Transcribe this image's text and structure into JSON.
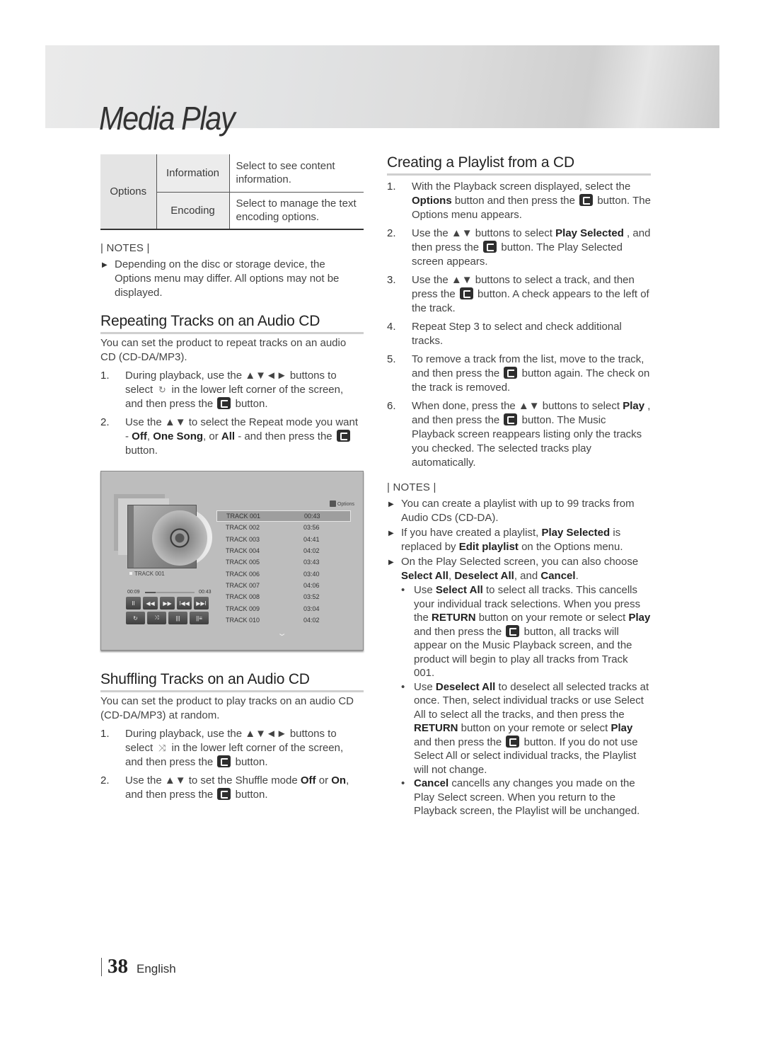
{
  "banner": {
    "title": "Media Play"
  },
  "options_table": {
    "group": "Options",
    "rows": [
      {
        "name": "Information",
        "desc": "Select to see content information."
      },
      {
        "name": "Encoding",
        "desc": "Select to manage the text encoding options."
      }
    ]
  },
  "notes_label": "| NOTES |",
  "left_notes": [
    "Depending on the disc or storage device, the Options menu may differ. All options may not be displayed."
  ],
  "repeat": {
    "title": "Repeating Tracks on an Audio CD",
    "intro": "You can set the product to repeat tracks on an audio CD (CD-DA/MP3).",
    "step1_num": "1.",
    "step1_a": "During playback, use the ▲▼◄► buttons to select",
    "step1_b": "in the lower left corner of the screen, and then press the",
    "step1_c": "button.",
    "step2_num": "2.",
    "step2_a": "Use the ▲▼ to select the Repeat mode you want -",
    "step2_off": "Off",
    "step2_sep1": ",",
    "step2_one": "One Song",
    "step2_sep2": ", or",
    "step2_all": "All",
    "step2_b": "- and then press the",
    "step2_c": "button."
  },
  "player": {
    "options_label": "Options",
    "now_playing": "TRACK 001",
    "time_current": "00:09",
    "time_total": "00:43",
    "progress": 0.21,
    "controls_row1": [
      "pause",
      "rewind",
      "fast-forward",
      "previous",
      "next"
    ],
    "controls_row1_glyphs": [
      "II",
      "◀◀",
      "▶▶",
      "I◀◀",
      "▶▶I"
    ],
    "controls_row2": [
      "repeat",
      "shuffle",
      "equalizer",
      "sound-settings"
    ],
    "controls_row2_glyphs": [
      "↻",
      "⤨",
      "|||",
      "||≡"
    ],
    "tracks": [
      {
        "name": "TRACK 001",
        "time": "00:43"
      },
      {
        "name": "TRACK 002",
        "time": "03:56"
      },
      {
        "name": "TRACK 003",
        "time": "04:41"
      },
      {
        "name": "TRACK 004",
        "time": "04:02"
      },
      {
        "name": "TRACK 005",
        "time": "03:43"
      },
      {
        "name": "TRACK 006",
        "time": "03:40"
      },
      {
        "name": "TRACK 007",
        "time": "04:06"
      },
      {
        "name": "TRACK 008",
        "time": "03:52"
      },
      {
        "name": "TRACK 009",
        "time": "03:04"
      },
      {
        "name": "TRACK 010",
        "time": "04:02"
      }
    ],
    "selected_index": 0,
    "more_glyph": "⌄"
  },
  "shuffle": {
    "title": "Shuffling Tracks on an Audio CD",
    "intro": "You can set the product to play tracks on an audio CD (CD-DA/MP3) at random.",
    "step1_num": "1.",
    "step1_a": "During playback, use the ▲▼◄► buttons to select",
    "step1_b": "in the lower left corner of the screen, and then press the",
    "step1_c": "button.",
    "step2_num": "2.",
    "step2_a": "Use the ▲▼ to set the Shuffle mode",
    "step2_off": "Off",
    "step2_or": "or",
    "step2_on": "On",
    "step2_b": ", and then press the",
    "step2_c": "button."
  },
  "playlist": {
    "title": "Creating a Playlist from a CD",
    "steps": [
      {
        "num": "1.",
        "a": "With the Playback screen displayed, select the",
        "bold": "Options",
        "b": "button and then press the",
        "c": "button. The Options menu appears."
      },
      {
        "num": "2.",
        "a": "Use the ▲▼ buttons to select",
        "bold": "Play Selected",
        "b": ", and then press the",
        "c": "button. The Play Selected screen appears."
      },
      {
        "num": "3.",
        "a": "Use the ▲▼ buttons to select a track, and then press the",
        "c": "button. A check appears to the left of the track."
      },
      {
        "num": "4.",
        "a": "Repeat Step 3 to select and check additional tracks."
      },
      {
        "num": "5.",
        "a": "To remove a track from the list, move to the track, and then press the",
        "c": "button again. The check on the track is removed."
      },
      {
        "num": "6.",
        "a": "When done, press the ▲▼ buttons to select",
        "bold": "Play",
        "b": ", and then press the",
        "c": "button. The Music Playback screen reappears listing only the tracks you checked. The selected tracks play automatically."
      }
    ],
    "notes": {
      "n1": "You can create a playlist with up to 99 tracks from Audio CDs (CD-DA).",
      "n2_a": "If you have created a playlist,",
      "n2_b1": "Play Selected",
      "n2_c": "is replaced by",
      "n2_b2": "Edit playlist",
      "n2_d": "on the Options menu.",
      "n3_a": "On the Play Selected screen, you can also choose",
      "n3_b1": "Select All",
      "n3_s1": ",",
      "n3_b2": "Deselect All",
      "n3_s2": ", and",
      "n3_b3": "Cancel",
      "n3_end": ".",
      "sub1_a": "Use",
      "sub1_b1": "Select All",
      "sub1_c": "to select all tracks. This cancells your individual track selections. When you press the",
      "sub1_b2": "RETURN",
      "sub1_d": "button on your remote or select",
      "sub1_b3": "Play",
      "sub1_e": "and then press the",
      "sub1_f": "button, all tracks will appear on the Music Playback screen, and the product will begin to play all tracks from Track 001.",
      "sub2_a": "Use",
      "sub2_b1": "Deselect All",
      "sub2_c": "to deselect all selected tracks at once. Then, select individual tracks or use Select All to select all the tracks, and then press the",
      "sub2_b2": "RETURN",
      "sub2_d": "button on your remote or select",
      "sub2_b3": "Play",
      "sub2_e": "and then press the",
      "sub2_f": "button. If you do not use Select All or select individual tracks, the Playlist will not change.",
      "sub3_b1": "Cancel",
      "sub3_c": "cancells any changes you made on the Play Select screen. When you return to the Playback screen, the Playlist will be unchanged."
    }
  },
  "footer": {
    "page": "38",
    "language": "English"
  }
}
